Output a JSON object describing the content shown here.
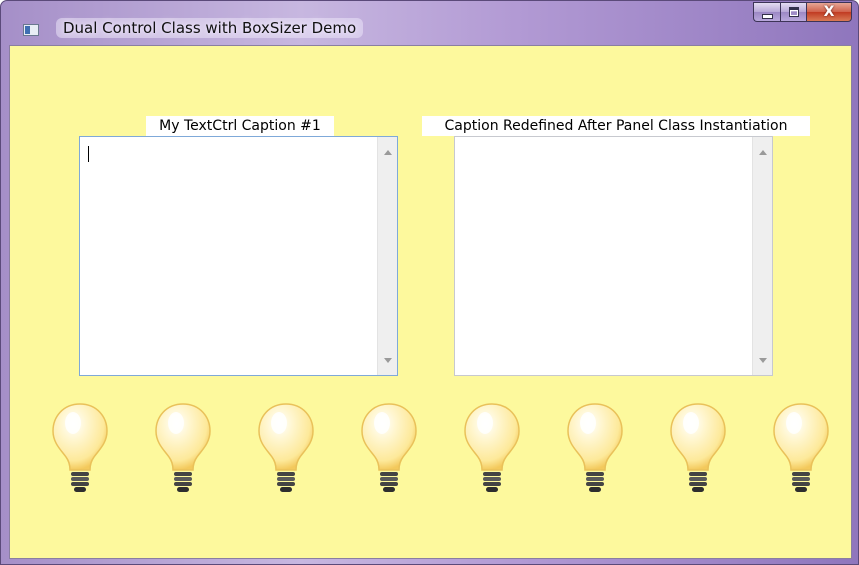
{
  "window": {
    "title": "Dual Control Class with BoxSizer Demo",
    "title_icon": "app-window-icon",
    "buttons": [
      "minimize-button",
      "maximize-button",
      "close-button"
    ],
    "close_glyph": "X"
  },
  "panels": [
    {
      "caption": "My TextCtrl Caption #1",
      "value": "",
      "focused": true
    },
    {
      "caption": "Caption Redefined After Panel Class Instantiation",
      "value": "",
      "focused": false
    }
  ],
  "bulbs": {
    "count": 8,
    "icon": "lightbulb-icon"
  },
  "colors": {
    "panel_background": "#fdf99d",
    "bulb_glass": "#fde99a",
    "bulb_base": "#444444",
    "focus_border": "#7fa9d9"
  }
}
